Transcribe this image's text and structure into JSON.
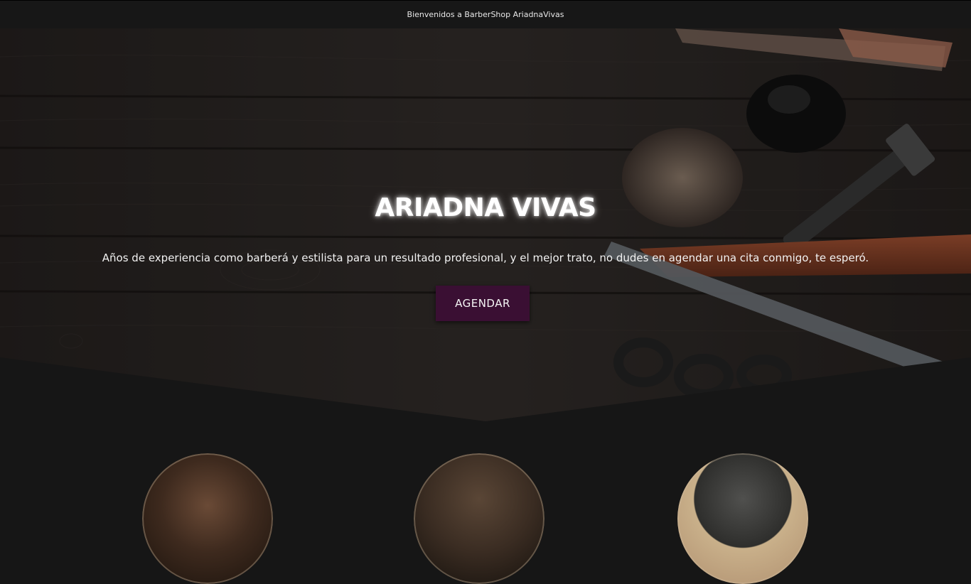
{
  "topbar": {
    "text": "Bienvenidos a BarberShop AriadnaVivas"
  },
  "hero": {
    "title": "ARIADNA VIVAS",
    "subtitle": "Años de experiencia como barberá y estilista para un resultado profesional, y el mejor trato, no dudes en agendar una cita conmigo, te esperó.",
    "cta_label": "AGENDAR"
  },
  "colors": {
    "page_background": "#161616",
    "topbar_background": "#171717",
    "cta_background": "#3a0f33",
    "text": "#ffffff"
  },
  "gallery": {
    "items": [
      {
        "icon": "portrait-photo-1"
      },
      {
        "icon": "portrait-photo-2"
      },
      {
        "icon": "portrait-photo-3"
      }
    ]
  }
}
